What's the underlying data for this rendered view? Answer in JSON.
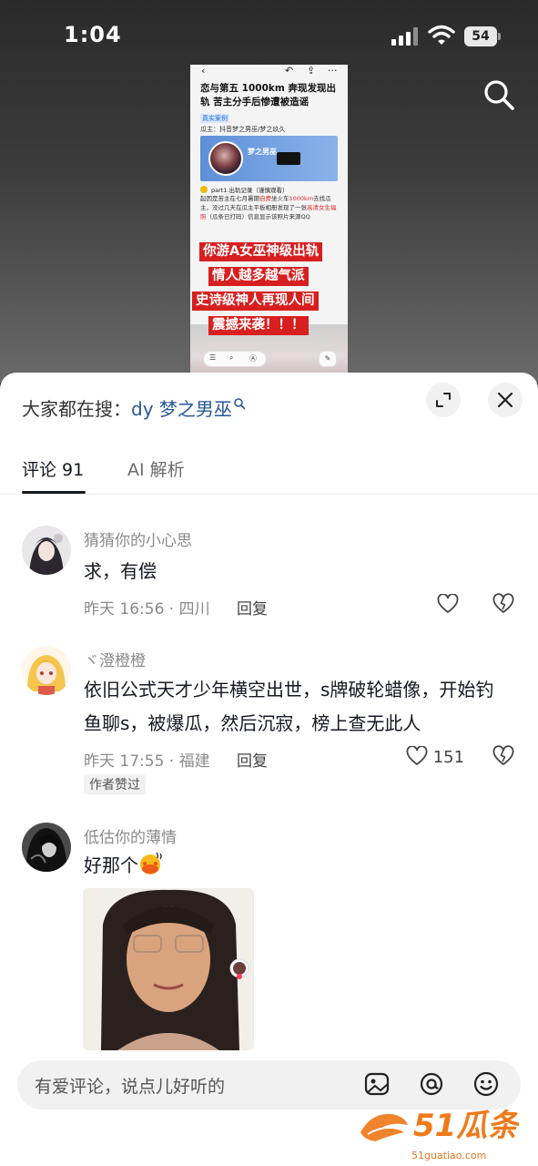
{
  "status_bar": {
    "time": "1:04",
    "battery": "54"
  },
  "preview": {
    "title": "恋与第五 1000km 奔现发现出轨 苦主分手后惨遭被造谣",
    "tag": "真实案例",
    "source": "瓜主：抖音梦之男巫/梦之玖久",
    "card_name": "梦之男巫",
    "part_label": "part1.出轨记录（谨慎观看）",
    "body_pre": "起因是苦主在七月暑期",
    "body_hl1": "自费",
    "body_mid": "坐火车",
    "body_hl2": "1000km",
    "body_post": "去找瓜主，没过几天在瓜主平板相册发现了一张",
    "body_hl3": "高清女生福照",
    "body_tail": "（瓜条已打码）信息显示该照片来源QQ",
    "banners": [
      "你游A女巫神级出轨",
      "情人越多越气派",
      "史诗级神人再现人间",
      "震撼来袭！！！"
    ]
  },
  "sheet": {
    "trending_prefix": "大家都在搜：",
    "trending_keyword": "dy 梦之男巫",
    "tabs": {
      "comments": "评论 91",
      "ai": "AI 解析"
    }
  },
  "comments": [
    {
      "user": "猜猜你的小心思",
      "text": "求，有偿",
      "meta": "昨天 16:56 · 四川",
      "reply": "回复",
      "likes": ""
    },
    {
      "user": "ヾ澄橙橙",
      "text": "依旧公式天才少年横空出世，s牌破轮蜡像，开始钓鱼聊s，被爆瓜，然后沉寂，榜上查无此人",
      "meta": "昨天 17:55 · 福建",
      "reply": "回复",
      "likes": "151",
      "badge": "作者赞过"
    },
    {
      "user": "低估你的薄情",
      "text": "好那个"
    }
  ],
  "input": {
    "placeholder": "有爱评论，说点儿好听的"
  },
  "watermark": {
    "text": "51瓜条",
    "url": "51guatiao.com"
  },
  "colors": {
    "keyword": "#27579a",
    "banner_red": "#d81f1f",
    "watermark_orange": "#ef7a1a"
  }
}
